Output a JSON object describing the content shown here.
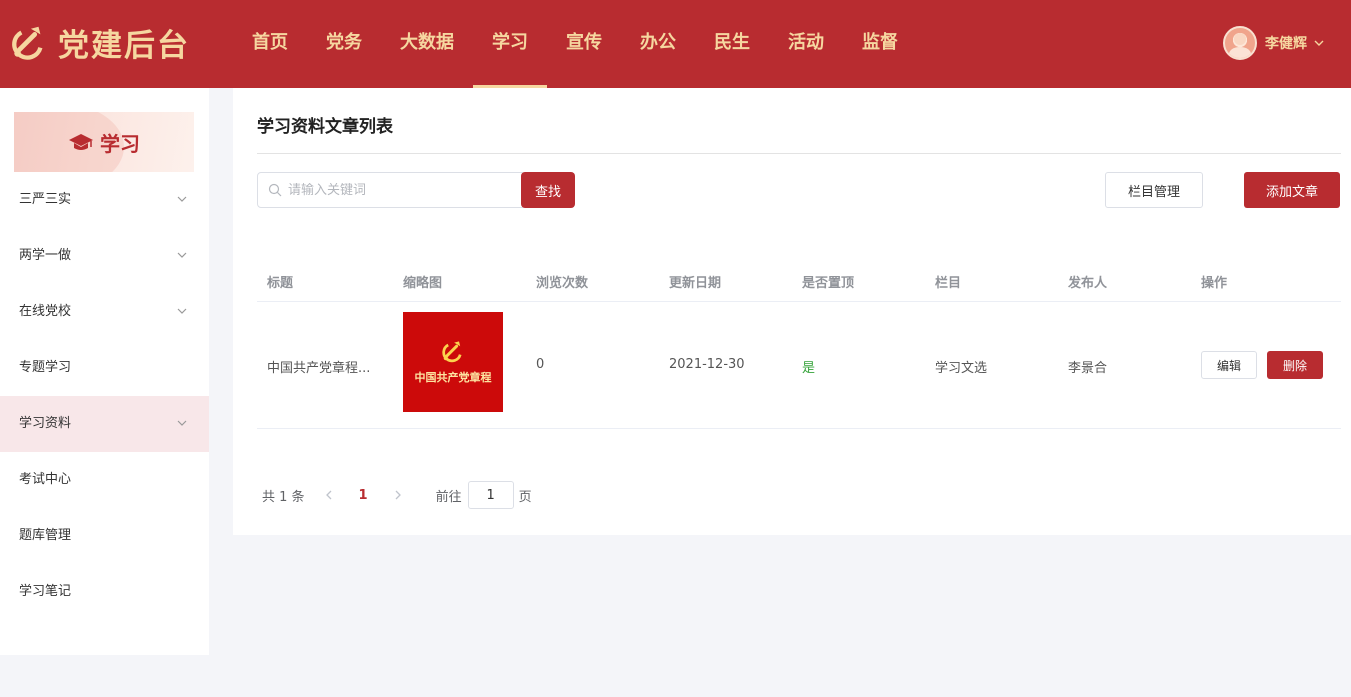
{
  "header": {
    "logo_text": "党建后台",
    "nav": [
      "首页",
      "党务",
      "大数据",
      "学习",
      "宣传",
      "办公",
      "民生",
      "活动",
      "监督"
    ],
    "active_nav": "学习",
    "user_name": "李健辉"
  },
  "sidebar": {
    "banner_text": "学习",
    "items": [
      {
        "label": "三严三实",
        "expandable": true
      },
      {
        "label": "两学一做",
        "expandable": true
      },
      {
        "label": "在线党校",
        "expandable": true
      },
      {
        "label": "专题学习",
        "expandable": false
      },
      {
        "label": "学习资料",
        "expandable": true,
        "active": true
      },
      {
        "label": "考试中心",
        "expandable": false
      },
      {
        "label": "题库管理",
        "expandable": false
      },
      {
        "label": "学习笔记",
        "expandable": false
      }
    ]
  },
  "main": {
    "title": "学习资料文章列表",
    "search": {
      "placeholder": "请输入关键词",
      "value": ""
    },
    "search_button": "查找",
    "column_manage_button": "栏目管理",
    "add_article_button": "添加文章",
    "table": {
      "columns": [
        "标题",
        "缩略图",
        "浏览次数",
        "更新日期",
        "是否置顶",
        "栏目",
        "发布人",
        "操作"
      ],
      "rows": [
        {
          "title": "中国共产党章程...",
          "thumbnail_text": "中国共产党章程",
          "views": "0",
          "updated": "2021-12-30",
          "pinned": "是",
          "column": "学习文选",
          "publisher": "李景合",
          "edit_label": "编辑",
          "delete_label": "删除"
        }
      ]
    },
    "pagination": {
      "total_text": "共 1 条",
      "current_page": "1",
      "goto_label": "前往",
      "goto_value": "1",
      "page_unit": "页"
    }
  },
  "colors": {
    "brand_red": "#b82c30",
    "gold": "#f6d7a0",
    "pinned_green": "#35a33a"
  },
  "icons": [
    "party-emblem-icon",
    "chevron-down-icon",
    "graduation-cap-icon",
    "search-icon",
    "chevron-left-icon",
    "chevron-right-icon"
  ]
}
